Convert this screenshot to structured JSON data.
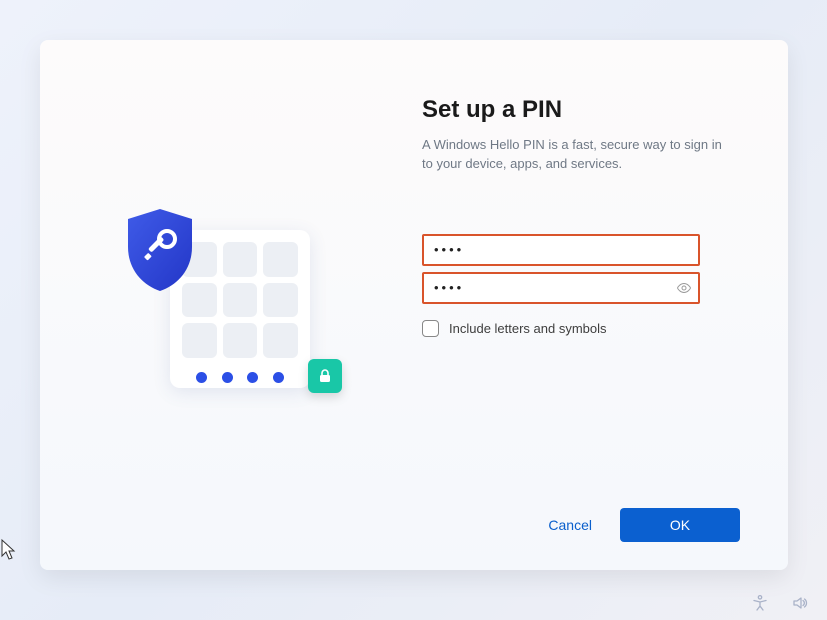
{
  "header": {
    "title": "Set up a PIN",
    "description": "A Windows Hello PIN is a fast, secure way to sign in to your device, apps, and services."
  },
  "form": {
    "pin_value_masked": "••••",
    "confirm_value_masked": "••••",
    "include_symbols_label": "Include letters and symbols",
    "include_symbols_checked": false
  },
  "buttons": {
    "cancel": "Cancel",
    "ok": "OK"
  },
  "icons": {
    "shield": "shield-key-icon",
    "lock": "lock-icon",
    "reveal": "eye-icon",
    "accessibility": "accessibility-icon",
    "sound": "sound-icon"
  },
  "colors": {
    "accent": "#0b60d0",
    "input_border_error": "#d9542b",
    "teal": "#19c7a7"
  }
}
